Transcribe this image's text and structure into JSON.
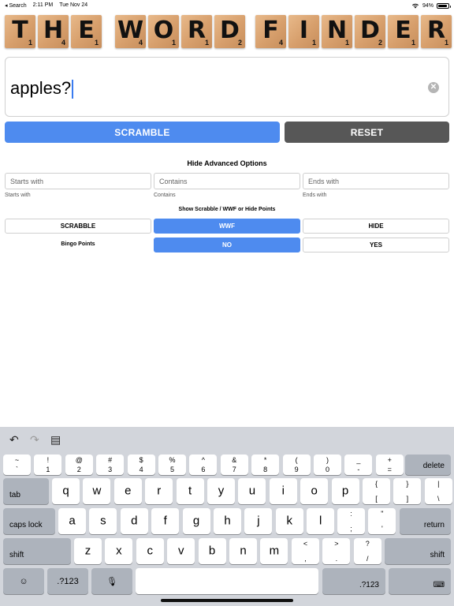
{
  "status": {
    "back": "◂ Search",
    "time": "2:11 PM",
    "date": "Tue Nov 24",
    "battery": "94%",
    "battery_level": 0.94
  },
  "title_tiles": [
    {
      "l": "T",
      "p": "1"
    },
    {
      "l": "H",
      "p": "4"
    },
    {
      "l": "E",
      "p": "1"
    },
    {
      "l": "W",
      "p": "4"
    },
    {
      "l": "O",
      "p": "1"
    },
    {
      "l": "R",
      "p": "1"
    },
    {
      "l": "D",
      "p": "2"
    },
    {
      "l": "F",
      "p": "4"
    },
    {
      "l": "I",
      "p": "1"
    },
    {
      "l": "N",
      "p": "1"
    },
    {
      "l": "D",
      "p": "2"
    },
    {
      "l": "E",
      "p": "1"
    },
    {
      "l": "R",
      "p": "1"
    }
  ],
  "search": {
    "value": "apples?",
    "clear_icon": "⊗"
  },
  "buttons": {
    "scramble": "SCRAMBLE",
    "reset": "RESET"
  },
  "advanced": {
    "toggle": "Hide Advanced Options",
    "starts_with": {
      "placeholder": "Starts with",
      "label": "Starts with"
    },
    "contains": {
      "placeholder": "Contains",
      "label": "Contains"
    },
    "ends_with": {
      "placeholder": "Ends with",
      "label": "Ends with"
    },
    "points_label": "Show Scrabble / WWF or Hide Points",
    "points_options": {
      "scrabble": "SCRABBLE",
      "wwf": "WWF",
      "hide": "HIDE"
    },
    "points_selected": "WWF",
    "bingo_label": "Bingo Points",
    "bingo_options": {
      "no": "NO",
      "yes": "YES"
    },
    "bingo_selected": "NO"
  },
  "colors": {
    "accent": "#4e8bef",
    "reset": "#575757",
    "tile": "#d79f6c"
  },
  "keyboard": {
    "toolbar": {
      "undo": "↶",
      "redo": "↷",
      "paste": "▤"
    },
    "num": [
      {
        "t": "~",
        "b": "`"
      },
      {
        "t": "!",
        "b": "1"
      },
      {
        "t": "@",
        "b": "2"
      },
      {
        "t": "#",
        "b": "3"
      },
      {
        "t": "$",
        "b": "4"
      },
      {
        "t": "%",
        "b": "5"
      },
      {
        "t": "^",
        "b": "6"
      },
      {
        "t": "&",
        "b": "7"
      },
      {
        "t": "*",
        "b": "8"
      },
      {
        "t": "(",
        "b": "9"
      },
      {
        "t": ")",
        "b": "0"
      },
      {
        "t": "_",
        "b": "-"
      },
      {
        "t": "+",
        "b": "="
      }
    ],
    "delete": "delete",
    "tab": "tab",
    "row1": [
      "q",
      "w",
      "e",
      "r",
      "t",
      "y",
      "u",
      "i",
      "o",
      "p"
    ],
    "row1_extra": [
      {
        "t": "{",
        "b": "["
      },
      {
        "t": "}",
        "b": "]"
      },
      {
        "t": "|",
        "b": "\\"
      }
    ],
    "caps": "caps lock",
    "row2": [
      "a",
      "s",
      "d",
      "f",
      "g",
      "h",
      "j",
      "k",
      "l"
    ],
    "row2_extra": [
      {
        "t": ":",
        "b": ";"
      },
      {
        "t": "\"",
        "b": "'"
      }
    ],
    "return": "return",
    "shift": "shift",
    "row3": [
      "z",
      "x",
      "c",
      "v",
      "b",
      "n",
      "m"
    ],
    "row3_extra": [
      {
        "t": "<",
        "b": ","
      },
      {
        "t": ">",
        "b": "."
      },
      {
        "t": "?",
        "b": "/"
      }
    ],
    "emoji": "☺",
    "num_toggle": ".?123",
    "mic": "🎙",
    "hide_kb": "⌨"
  }
}
